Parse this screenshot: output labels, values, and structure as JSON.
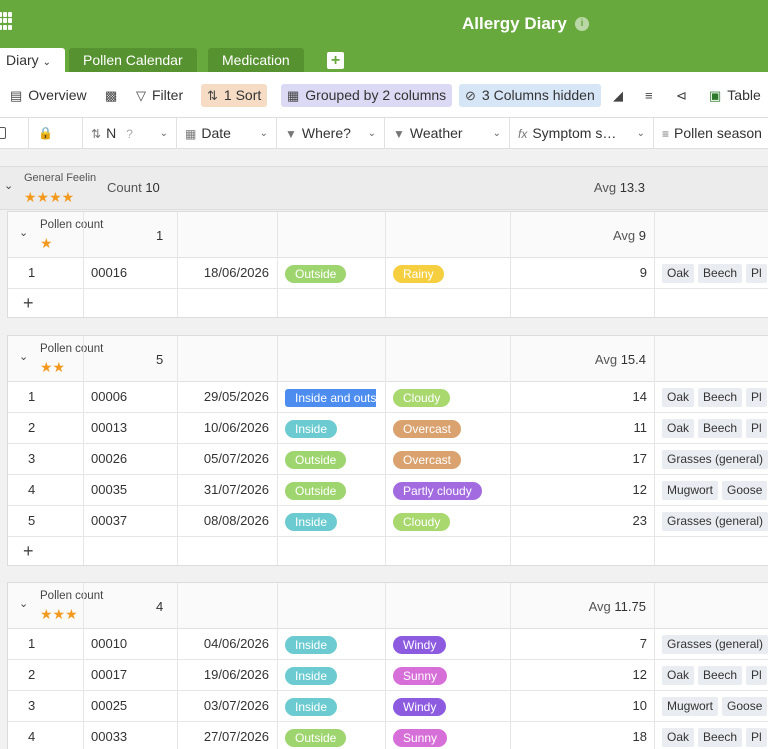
{
  "app": {
    "title": "Allergy Diary"
  },
  "tabs": [
    {
      "label": "Diary",
      "active": true
    },
    {
      "label": "Pollen Calendar",
      "active": false
    },
    {
      "label": "Medication",
      "active": false
    }
  ],
  "toolbar": {
    "overview": "Overview",
    "filter": "Filter",
    "sort": "1 Sort",
    "grouped": "Grouped by 2 columns",
    "hidden": "3 Columns hidden",
    "table": "Table"
  },
  "columns": {
    "n": "N",
    "date": "Date",
    "where": "Where?",
    "weather": "Weather",
    "symptom": "Symptom s…",
    "pollen_season": "Pollen season"
  },
  "group1": {
    "label": "General Feelin",
    "stars": 4,
    "count_label": "Count",
    "count": "10",
    "avg_label": "Avg",
    "avg": "13.3"
  },
  "colors": {
    "Outside": "#9fd56e",
    "Inside": "#6ccbd0",
    "Inside and outs": "#4d8df0",
    "Rainy": "#f5cf3f",
    "Cloudy": "#a9d86e",
    "Overcast": "#d9a26f",
    "Partly cloudy": "#a36be0",
    "Windy": "#8d5be0",
    "Sunny": "#d76fd8"
  },
  "subgroups": [
    {
      "label": "Pollen count",
      "stars": 1,
      "count": "1",
      "avg_label": "Avg",
      "avg": "9",
      "rows": [
        {
          "idx": "1",
          "n": "00016",
          "date": "18/06/2026",
          "where": "Outside",
          "weather": "Rainy",
          "symptom": "9",
          "tags": [
            "Oak",
            "Beech",
            "Pl"
          ]
        }
      ],
      "add": true
    },
    {
      "label": "Pollen count",
      "stars": 2,
      "count": "5",
      "avg_label": "Avg",
      "avg": "15.4",
      "rows": [
        {
          "idx": "1",
          "n": "00006",
          "date": "29/05/2026",
          "where": "Inside and outs",
          "weather": "Cloudy",
          "symptom": "14",
          "tags": [
            "Oak",
            "Beech",
            "Pl"
          ]
        },
        {
          "idx": "2",
          "n": "00013",
          "date": "10/06/2026",
          "where": "Inside",
          "weather": "Overcast",
          "symptom": "11",
          "tags": [
            "Oak",
            "Beech",
            "Pl"
          ]
        },
        {
          "idx": "3",
          "n": "00026",
          "date": "05/07/2026",
          "where": "Outside",
          "weather": "Overcast",
          "symptom": "17",
          "tags": [
            "Grasses (general)"
          ]
        },
        {
          "idx": "4",
          "n": "00035",
          "date": "31/07/2026",
          "where": "Outside",
          "weather": "Partly cloudy",
          "symptom": "12",
          "tags": [
            "Mugwort",
            "Goose"
          ]
        },
        {
          "idx": "5",
          "n": "00037",
          "date": "08/08/2026",
          "where": "Inside",
          "weather": "Cloudy",
          "symptom": "23",
          "tags": [
            "Grasses (general)"
          ]
        }
      ],
      "add": true
    },
    {
      "label": "Pollen count",
      "stars": 3,
      "count": "4",
      "avg_label": "Avg",
      "avg": "11.75",
      "rows": [
        {
          "idx": "1",
          "n": "00010",
          "date": "04/06/2026",
          "where": "Inside",
          "weather": "Windy",
          "symptom": "7",
          "tags": [
            "Grasses (general)"
          ]
        },
        {
          "idx": "2",
          "n": "00017",
          "date": "19/06/2026",
          "where": "Inside",
          "weather": "Sunny",
          "symptom": "12",
          "tags": [
            "Oak",
            "Beech",
            "Pl"
          ]
        },
        {
          "idx": "3",
          "n": "00025",
          "date": "03/07/2026",
          "where": "Inside",
          "weather": "Windy",
          "symptom": "10",
          "tags": [
            "Mugwort",
            "Goose"
          ]
        },
        {
          "idx": "4",
          "n": "00033",
          "date": "27/07/2026",
          "where": "Outside",
          "weather": "Sunny",
          "symptom": "18",
          "tags": [
            "Oak",
            "Beech",
            "Pl"
          ]
        }
      ],
      "add": false
    }
  ]
}
